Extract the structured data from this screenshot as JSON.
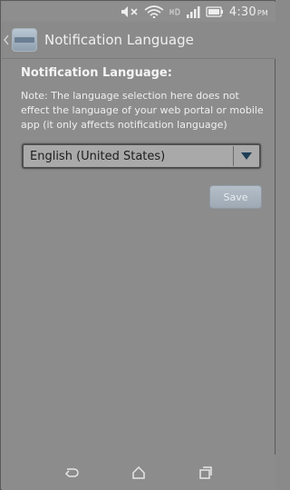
{
  "status_bar": {
    "time": "4:30",
    "ampm": "PM",
    "icons": [
      "mute-icon",
      "wifi-icon",
      "signal-icon",
      "battery-icon"
    ]
  },
  "action_bar": {
    "title": "Notification Language"
  },
  "content": {
    "heading": "Notification Language:",
    "note": "Note: The language selection here does not effect the language of your web portal or mobile app (it only affects notification language)",
    "language_select": {
      "selected": "English (United States)"
    },
    "save_label": "Save"
  },
  "nav_bar": {
    "buttons": [
      "back-icon",
      "home-icon",
      "recent-apps-icon"
    ]
  },
  "colors": {
    "overlay_gray": "#8c8c8c",
    "text_light": "#f0f0f0",
    "dropdown_arrow": "#1f3f57"
  }
}
